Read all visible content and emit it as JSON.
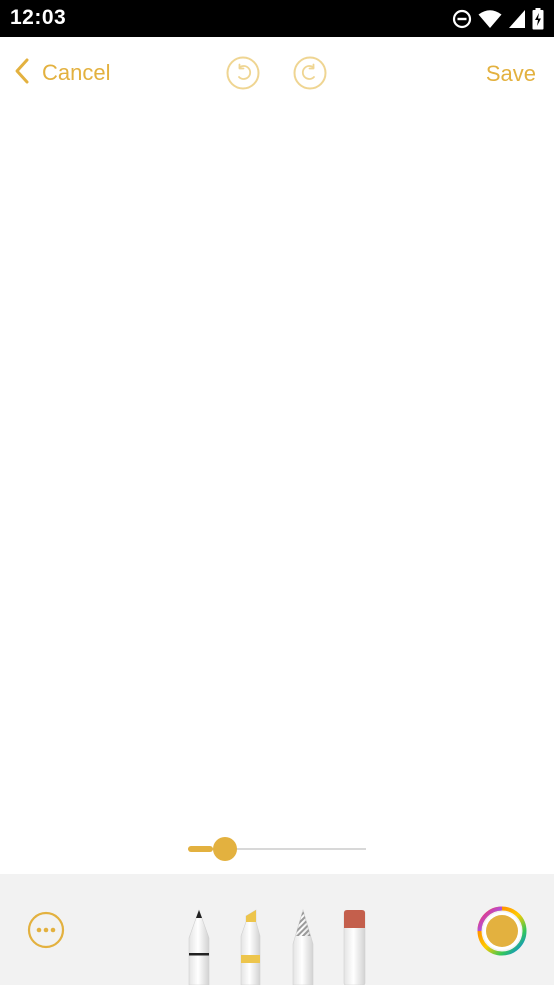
{
  "status_bar": {
    "time": "12:03",
    "icons": [
      "do-not-disturb-icon",
      "wifi-icon",
      "cell-signal-icon",
      "battery-charging-icon"
    ]
  },
  "toolbar": {
    "cancel_label": "Cancel",
    "save_label": "Save",
    "undo_icon": "undo-icon",
    "redo_icon": "redo-icon"
  },
  "stroke_width": {
    "level": 0.14
  },
  "tools": [
    {
      "name": "pen",
      "icon": "pen-icon"
    },
    {
      "name": "marker",
      "icon": "marker-icon"
    },
    {
      "name": "pencil",
      "icon": "pencil-icon"
    },
    {
      "name": "eraser",
      "icon": "eraser-icon"
    }
  ],
  "more_icon": "more-options-icon",
  "colors": {
    "accent": "#e3b13f",
    "selected_color": "#e3b13f",
    "tray_background": "#f2f2f2",
    "status_bar": "#000000"
  }
}
